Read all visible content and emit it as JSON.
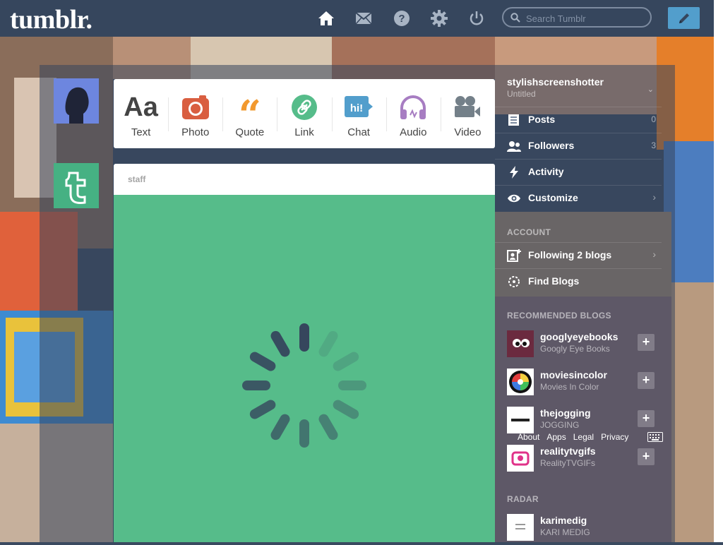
{
  "app": {
    "logo": "tumblr."
  },
  "nav": {
    "icons": [
      {
        "name": "home-icon",
        "label": "Dashboard"
      },
      {
        "name": "mail-icon",
        "label": "Messages"
      },
      {
        "name": "help-icon",
        "label": "Help"
      },
      {
        "name": "gear-icon",
        "label": "Settings"
      },
      {
        "name": "power-icon",
        "label": "Log out"
      }
    ],
    "search_placeholder": "Search Tumblr",
    "compose_icon": "pencil-icon"
  },
  "post_types": [
    {
      "label": "Text",
      "icon": "text-icon",
      "color": "#444444"
    },
    {
      "label": "Photo",
      "icon": "camera-icon",
      "color": "#d95e40"
    },
    {
      "label": "Quote",
      "icon": "quote-icon",
      "color": "#f2992e"
    },
    {
      "label": "Link",
      "icon": "link-icon",
      "color": "#56bc8a"
    },
    {
      "label": "Chat",
      "icon": "chat-icon",
      "color": "#529ecc"
    },
    {
      "label": "Audio",
      "icon": "headphones-icon",
      "color": "#a77dc2"
    },
    {
      "label": "Video",
      "icon": "video-camera-icon",
      "color": "#748089"
    }
  ],
  "post": {
    "author": "staff",
    "body_color": "#56bc8a",
    "state": "loading"
  },
  "sidebar": {
    "blog_name": "stylishscreenshotter",
    "blog_title": "Untitled",
    "items": [
      {
        "label": "Posts",
        "count": "0",
        "icon": "posts-icon"
      },
      {
        "label": "Followers",
        "count": "3",
        "icon": "followers-icon"
      },
      {
        "label": "Activity",
        "count": "",
        "icon": "activity-icon"
      },
      {
        "label": "Customize",
        "count": "",
        "icon": "eye-icon"
      }
    ],
    "account_label": "ACCOUNT",
    "account_items": [
      {
        "label": "Following 2 blogs",
        "icon": "following-icon"
      },
      {
        "label": "Find Blogs",
        "icon": "find-blogs-icon"
      }
    ],
    "recommended_label": "RECOMMENDED BLOGS",
    "recommended": [
      {
        "name": "googlyeyebooks",
        "title": "Googly Eye Books"
      },
      {
        "name": "moviesincolor",
        "title": "Movies In Color"
      },
      {
        "name": "thejogging",
        "title": "JOGGING"
      },
      {
        "name": "realitytvgifs",
        "title": "RealityTVGIFs"
      }
    ],
    "footer_links": [
      "About",
      "Apps",
      "Legal",
      "Privacy"
    ],
    "radar_label": "RADAR",
    "radar": {
      "name": "karimedig",
      "title": "KARI MEDIG"
    }
  },
  "colors": {
    "header": "#36465d",
    "compose": "#529ecc",
    "staff_avatar": "#46b183"
  }
}
